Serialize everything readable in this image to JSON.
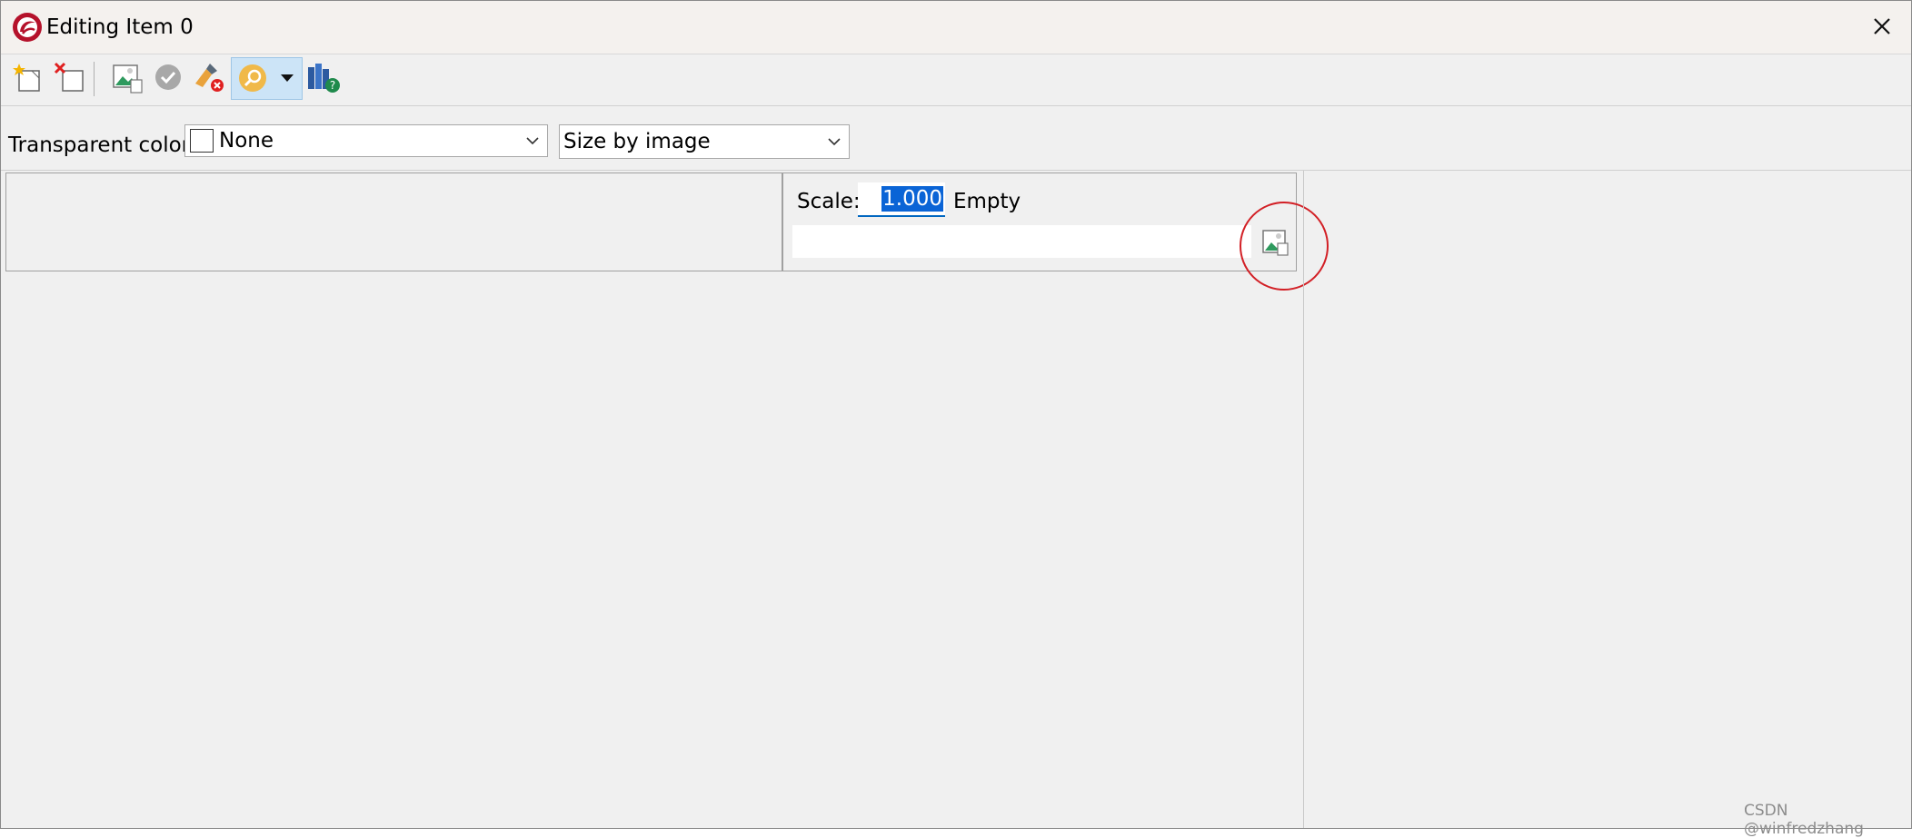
{
  "window": {
    "title": "Editing Item 0"
  },
  "toolbar": {
    "buttons": [
      {
        "name": "new-item-icon"
      },
      {
        "name": "delete-item-icon"
      },
      {
        "name": "image-icon"
      },
      {
        "name": "check-icon"
      },
      {
        "name": "clear-brush-icon"
      },
      {
        "name": "search-icon"
      },
      {
        "name": "dropdown-arrow-icon"
      },
      {
        "name": "library-help-icon"
      }
    ]
  },
  "options": {
    "transparent_label": "Transparent color:",
    "transparent_value": "None",
    "size_mode_value": "Size by image"
  },
  "editor": {
    "scale_label": "Scale:",
    "scale_value": "1.000",
    "status_text": "Empty",
    "path_value": ""
  },
  "watermark": "CSDN @winfredzhang",
  "colors": {
    "accent": "#0a64d6",
    "highlight_circle": "#d21f25",
    "app_logo": "#b5122b"
  }
}
